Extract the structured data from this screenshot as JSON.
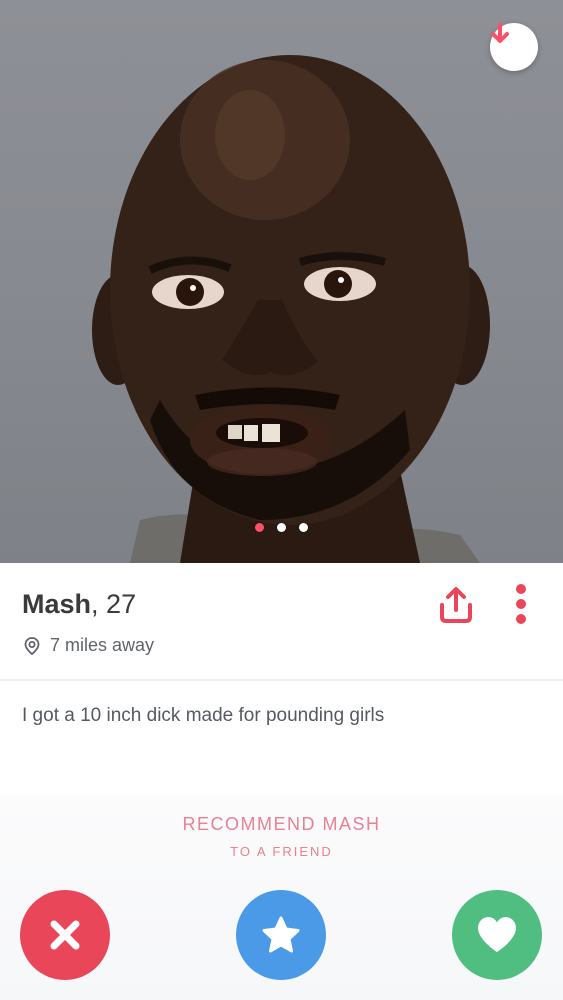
{
  "profile": {
    "name": "Mash",
    "age": "27",
    "distance": "7 miles away",
    "bio": "I got a 10 inch dick made for pounding girls"
  },
  "photo": {
    "count": 3,
    "active_index": 0
  },
  "recommend": {
    "title": "RECOMMEND MASH",
    "subtitle": "TO A FRIEND"
  },
  "icons": {
    "collapse": "arrow-down-icon",
    "location": "location-pin-icon",
    "share": "share-icon",
    "more": "more-vertical-icon",
    "nope": "close-icon",
    "super_like": "star-icon",
    "like": "heart-icon"
  },
  "colors": {
    "brand_pink": "#fd5068",
    "nope_red": "#e9465a",
    "super_like_blue": "#4b9ae8",
    "like_green": "#4fbe80",
    "recommend_text": "#e88191"
  }
}
